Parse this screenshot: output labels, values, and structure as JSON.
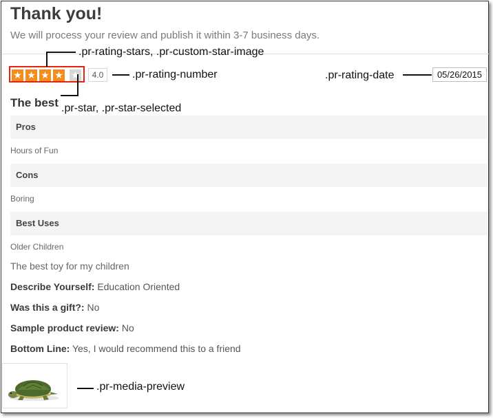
{
  "header": {
    "title": "Thank you!",
    "subtitle": "We will process your review and publish it within 3-7 business days."
  },
  "review": {
    "rating_number": "4.0",
    "rating_stars": 4,
    "rating_max": 5,
    "date": "05/26/2015",
    "headline": "The best",
    "sections": [
      {
        "label": "Pros",
        "value": "Hours of Fun"
      },
      {
        "label": "Cons",
        "value": "Boring"
      },
      {
        "label": "Best Uses",
        "value": "Older Children"
      }
    ],
    "comments": "The best toy for my children",
    "attributes": [
      {
        "label": "Describe Yourself:",
        "value": "Education Oriented"
      },
      {
        "label": "Was this a gift?:",
        "value": "No"
      },
      {
        "label": "Sample product review:",
        "value": "No"
      },
      {
        "label": "Bottom Line:",
        "value": "Yes, I would recommend this to a friend"
      }
    ]
  },
  "annotations": {
    "rating_stars": ".pr-rating-stars, .pr-custom-star-image",
    "rating_number": ".pr-rating-number",
    "rating_date": ".pr-rating-date",
    "star": ".pr-star, .pr-star-selected",
    "media_preview": ".pr-media-preview"
  },
  "colors": {
    "star_selected": "#f48d1c",
    "star_empty": "#d6d6d6",
    "highlight_border": "#e8210f"
  }
}
